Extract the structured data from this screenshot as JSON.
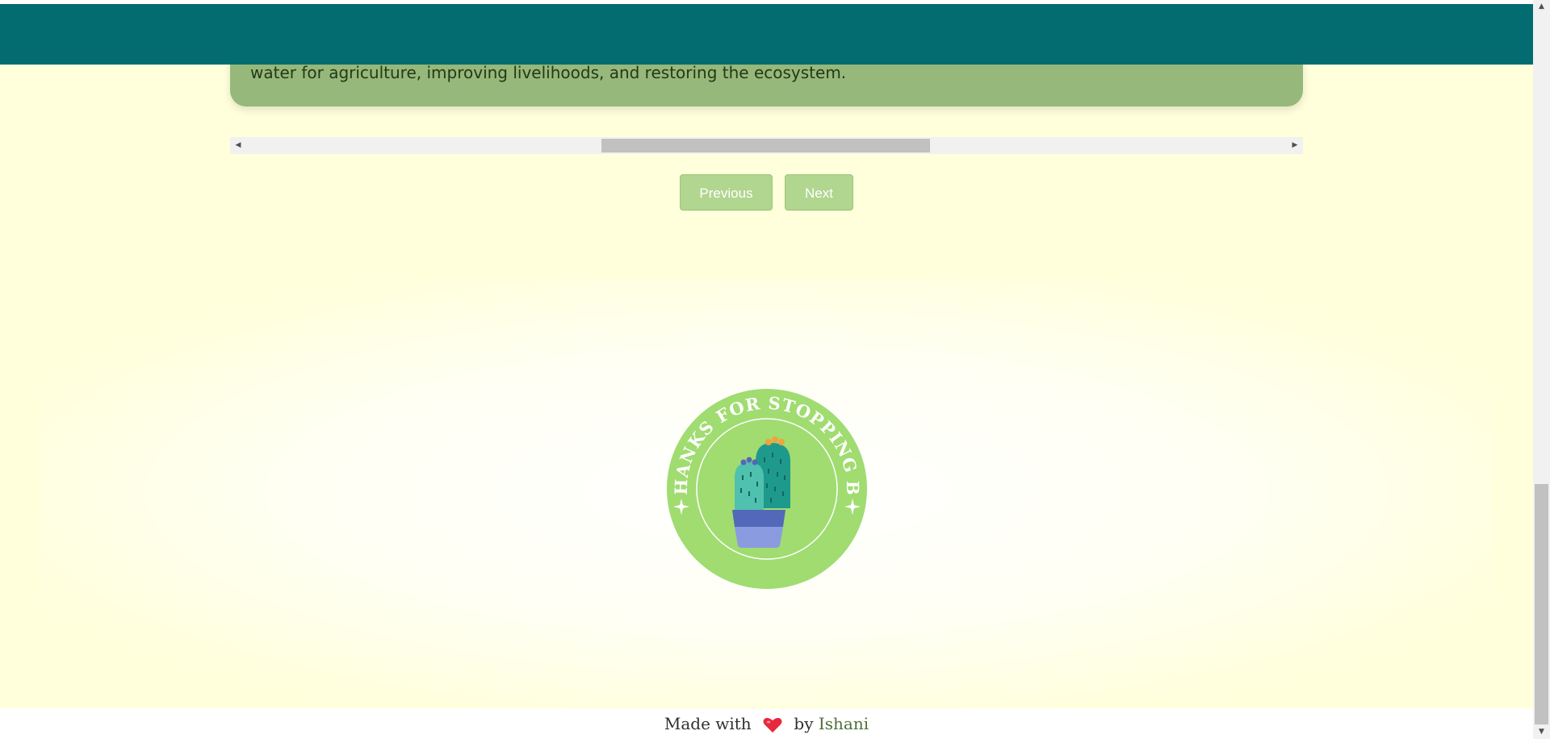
{
  "card": {
    "text": "water for agriculture, improving livelihoods, and restoring the ecosystem."
  },
  "carousel": {
    "scroll_left_glyph": "◀",
    "scroll_right_glyph": "▶",
    "previous_label": "Previous",
    "next_label": "Next"
  },
  "badge": {
    "text": "THANKS FOR STOPPING BY",
    "icon": "cactus-icon"
  },
  "footer": {
    "made_with": "Made with",
    "heart_icon": "heart-icon",
    "by": "by",
    "author": "Ishani"
  },
  "page_scrollbar": {
    "up_glyph": "▲",
    "down_glyph": "▼"
  },
  "colors": {
    "header": "#026c71",
    "background": "#ffffdc",
    "card": "#96b87a",
    "button": "#b0d68f",
    "badge": "#a0dc70",
    "heart": "#e8283c"
  }
}
